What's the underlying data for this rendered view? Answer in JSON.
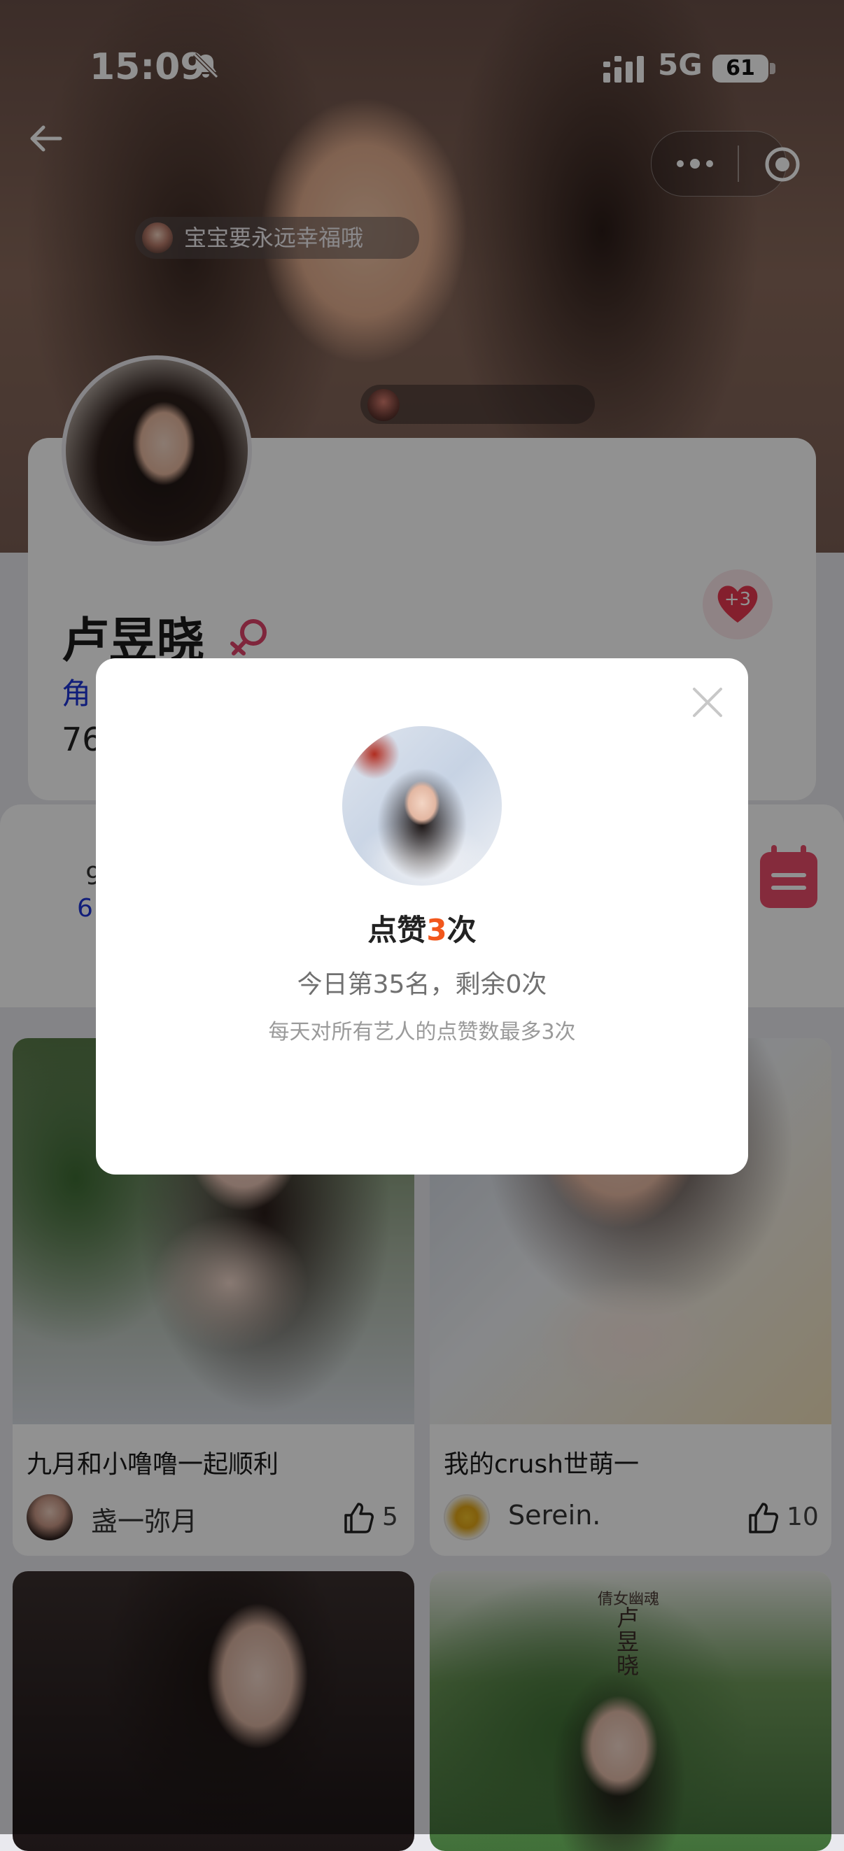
{
  "status_bar": {
    "time": "15:09",
    "network": "5G",
    "battery": "61"
  },
  "header": {
    "greeting": "宝宝要永远幸福哦"
  },
  "profile": {
    "name": "卢昱晓",
    "role_label": "角",
    "count": "76",
    "like_badge": "+3"
  },
  "stats": {
    "line1": "",
    "line2": "9",
    "line3": "6"
  },
  "posts": [
    {
      "title": "九月和小噜噜一起顺利",
      "author": "盏一弥月",
      "likes": "5"
    },
    {
      "title": "我的crush世萌一",
      "author": "Serein.",
      "likes": "10"
    },
    {
      "title": "",
      "author": "",
      "likes": ""
    },
    {
      "title": "",
      "author": "",
      "likes": "",
      "poster_small": "倩女幽魂",
      "poster_title": "卢昱晓"
    }
  ],
  "modal": {
    "title_prefix": "点赞",
    "title_count": "3",
    "title_suffix": "次",
    "rank_text": "今日第35名，剩余0次",
    "rule_text": "每天对所有艺人的点赞数最多3次"
  },
  "colors": {
    "accent": "#f2571c",
    "link_blue": "#1f36d6",
    "heart": "#e8384f"
  },
  "icons": [
    "bell-muted-icon",
    "signal-icon",
    "back-arrow-icon",
    "more-dots-icon",
    "target-icon",
    "heart-icon",
    "female-icon",
    "calendar-icon",
    "thumbs-up-icon",
    "close-icon"
  ]
}
